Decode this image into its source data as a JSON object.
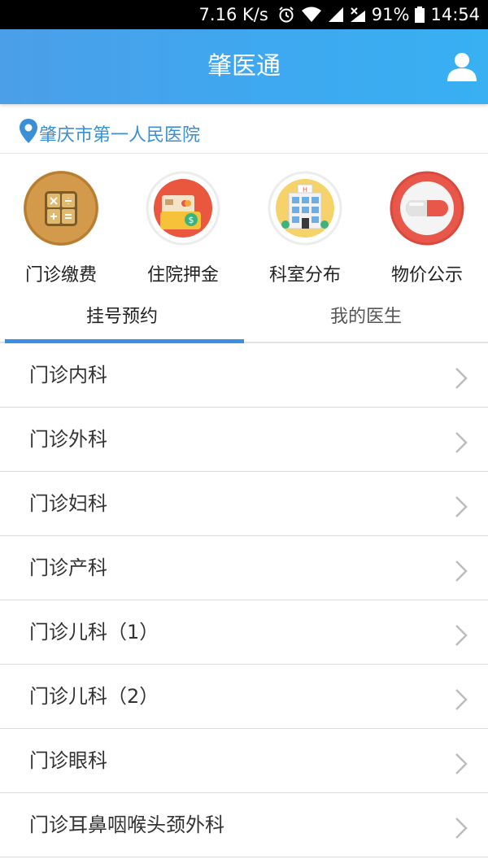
{
  "status_bar": {
    "net_speed": "7.16 K/s",
    "battery": "91%",
    "time": "14:54",
    "icons": [
      "alarm-icon",
      "wifi-icon",
      "signal-icon",
      "signal-x-icon",
      "battery-icon"
    ]
  },
  "header": {
    "title": "肇医通",
    "user_icon": "user-icon",
    "colors": {
      "gradient_start": "#4b9fe8",
      "gradient_end": "#38b0f2"
    }
  },
  "location": {
    "icon": "location-pin-icon",
    "hospital": "肇庆市第一人民医院",
    "color": "#3a8fd6"
  },
  "quick_menu": [
    {
      "label": "门诊缴费",
      "icon": "calculator-icon"
    },
    {
      "label": "住院押金",
      "icon": "wallet-card-icon"
    },
    {
      "label": "科室分布",
      "icon": "hospital-building-icon"
    },
    {
      "label": "物价公示",
      "icon": "pill-capsule-icon"
    }
  ],
  "tabs": [
    {
      "label": "挂号预约",
      "active": true
    },
    {
      "label": "我的医生",
      "active": false
    }
  ],
  "departments": [
    "门诊内科",
    "门诊外科",
    "门诊妇科",
    "门诊产科",
    "门诊儿科（1）",
    "门诊儿科（2）",
    "门诊眼科",
    "门诊耳鼻咽喉头颈外科"
  ]
}
